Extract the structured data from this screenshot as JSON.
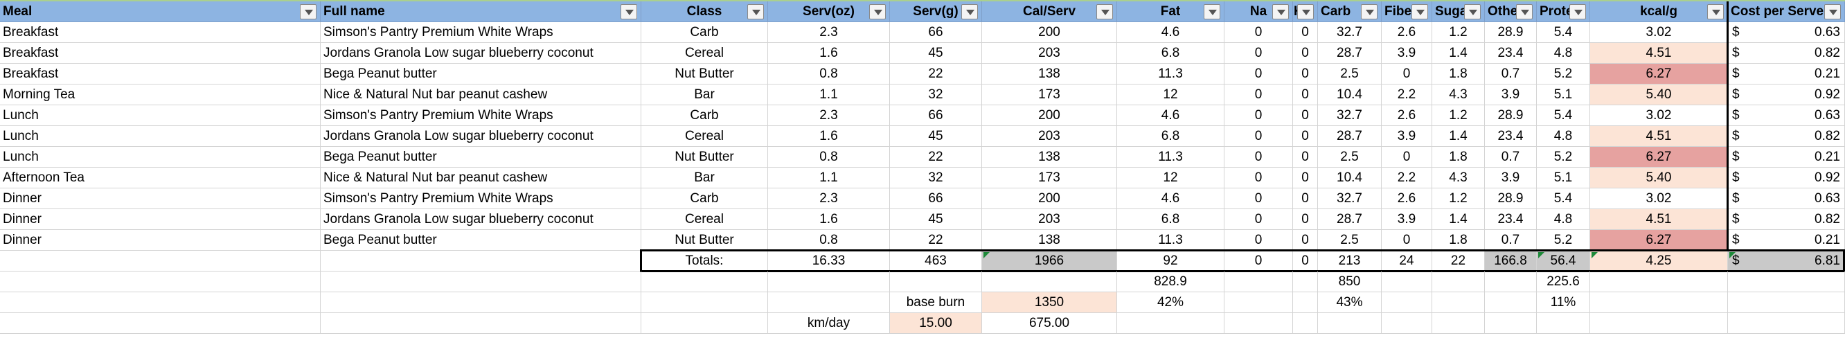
{
  "headers": [
    "Meal",
    "Full name",
    "Class",
    "Serv(oz)",
    "Serv(g)",
    "Cal/Serv",
    "Fat",
    "Na",
    "K",
    "Carb",
    "Fibe",
    "Suga",
    "Othe",
    "Prote",
    "kcal/g",
    "Cost per Serve"
  ],
  "rows": [
    [
      "Breakfast",
      "Simson's Pantry  Premium White Wraps",
      "Carb",
      "2.3",
      "66",
      "200",
      "4.6",
      "0",
      "0",
      "32.7",
      "2.6",
      "1.2",
      "28.9",
      "5.4",
      "3.02",
      "0.63"
    ],
    [
      "Breakfast",
      "Jordans Granola Low sugar blueberry coconut",
      "Cereal",
      "1.6",
      "45",
      "203",
      "6.8",
      "0",
      "0",
      "28.7",
      "3.9",
      "1.4",
      "23.4",
      "4.8",
      "4.51",
      "0.82"
    ],
    [
      "Breakfast",
      "Bega Peanut butter",
      "Nut Butter",
      "0.8",
      "22",
      "138",
      "11.3",
      "0",
      "0",
      "2.5",
      "0",
      "1.8",
      "0.7",
      "5.2",
      "6.27",
      "0.21"
    ],
    [
      "Morning Tea",
      "Nice & Natural Nut bar peanut cashew",
      "Bar",
      "1.1",
      "32",
      "173",
      "12",
      "0",
      "0",
      "10.4",
      "2.2",
      "4.3",
      "3.9",
      "5.1",
      "5.40",
      "0.92"
    ],
    [
      "Lunch",
      "Simson's Pantry  Premium White Wraps",
      "Carb",
      "2.3",
      "66",
      "200",
      "4.6",
      "0",
      "0",
      "32.7",
      "2.6",
      "1.2",
      "28.9",
      "5.4",
      "3.02",
      "0.63"
    ],
    [
      "Lunch",
      "Jordans Granola Low sugar blueberry coconut",
      "Cereal",
      "1.6",
      "45",
      "203",
      "6.8",
      "0",
      "0",
      "28.7",
      "3.9",
      "1.4",
      "23.4",
      "4.8",
      "4.51",
      "0.82"
    ],
    [
      "Lunch",
      "Bega Peanut butter",
      "Nut Butter",
      "0.8",
      "22",
      "138",
      "11.3",
      "0",
      "0",
      "2.5",
      "0",
      "1.8",
      "0.7",
      "5.2",
      "6.27",
      "0.21"
    ],
    [
      "Afternoon Tea",
      "Nice & Natural Nut bar peanut cashew",
      "Bar",
      "1.1",
      "32",
      "173",
      "12",
      "0",
      "0",
      "10.4",
      "2.2",
      "4.3",
      "3.9",
      "5.1",
      "5.40",
      "0.92"
    ],
    [
      "Dinner",
      "Simson's Pantry  Premium White Wraps",
      "Carb",
      "2.3",
      "66",
      "200",
      "4.6",
      "0",
      "0",
      "32.7",
      "2.6",
      "1.2",
      "28.9",
      "5.4",
      "3.02",
      "0.63"
    ],
    [
      "Dinner",
      "Jordans Granola Low sugar blueberry coconut",
      "Cereal",
      "1.6",
      "45",
      "203",
      "6.8",
      "0",
      "0",
      "28.7",
      "3.9",
      "1.4",
      "23.4",
      "4.8",
      "4.51",
      "0.82"
    ],
    [
      "Dinner",
      "Bega Peanut butter",
      "Nut Butter",
      "0.8",
      "22",
      "138",
      "11.3",
      "0",
      "0",
      "2.5",
      "0",
      "1.8",
      "0.7",
      "5.2",
      "6.27",
      "0.21"
    ]
  ],
  "kcal_highlight": {
    "3.02": "none",
    "4.51": "peach",
    "5.40": "peach",
    "6.27": "pink"
  },
  "currency_symbol": "$",
  "totals": {
    "label": "Totals:",
    "serv_oz": "16.33",
    "serv_g": "463",
    "cal": "1966",
    "fat": "92",
    "na": "0",
    "k": "0",
    "carb": "213",
    "fibe": "24",
    "suga": "22",
    "othe": "166.8",
    "prote": "56.4",
    "kcal_g": "4.25",
    "cost": "6.81"
  },
  "calc_row": {
    "fat": "828.9",
    "carb": "850",
    "prote": "225.6"
  },
  "burn_row": {
    "label": "base burn",
    "value": "1350",
    "fat_pct": "42%",
    "carb_pct": "43%",
    "prote_pct": "11%"
  },
  "km_row": {
    "label": "km/day",
    "value": "15.00",
    "result": "675.00"
  },
  "colors": {
    "header": "#8db4e2",
    "peach": "#fce4d6",
    "pink": "#e6a2a0",
    "grey": "#c9c9c9",
    "flag": "#1e8a3a"
  }
}
